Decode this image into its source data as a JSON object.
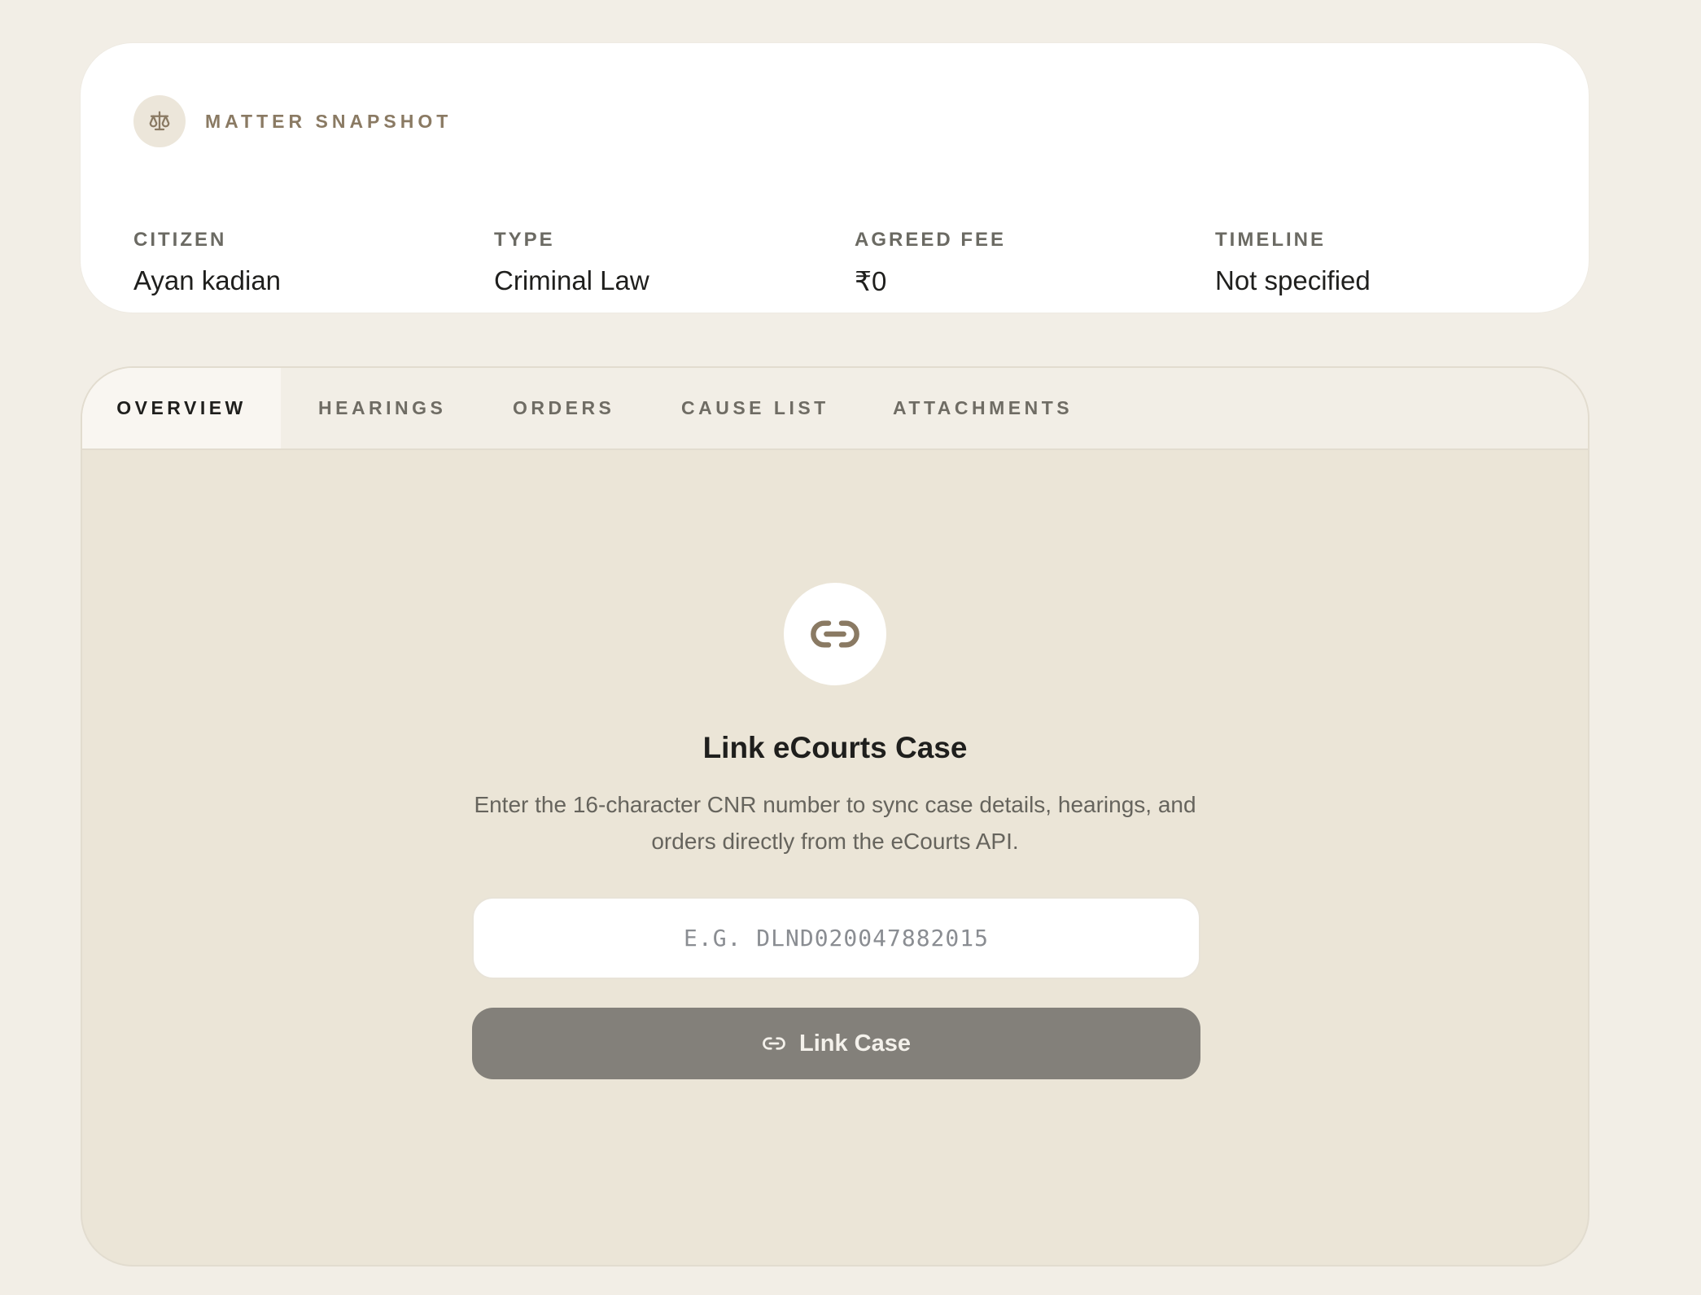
{
  "snapshot": {
    "title": "MATTER SNAPSHOT",
    "icon": "scale-icon",
    "fields": {
      "citizen": {
        "label": "CITIZEN",
        "value": "Ayan kadian"
      },
      "type": {
        "label": "TYPE",
        "value": "Criminal Law"
      },
      "fee": {
        "label": "AGREED FEE",
        "value": "₹0"
      },
      "timeline": {
        "label": "TIMELINE",
        "value": "Not specified"
      }
    }
  },
  "tabs": {
    "active": "OVERVIEW",
    "items": [
      "OVERVIEW",
      "HEARINGS",
      "ORDERS",
      "CAUSE LIST",
      "ATTACHMENTS"
    ]
  },
  "link_case": {
    "icon": "link-icon",
    "title": "Link eCourts Case",
    "description": "Enter the 16-character CNR number to sync case details, hearings, and orders directly from the eCourts API.",
    "input_value": "",
    "input_placeholder": "e.g. DLND020047882015",
    "button_label": "Link Case"
  },
  "colors": {
    "page_bg": "#f2eee6",
    "accent_brown": "#8a7a63",
    "panel_bg": "#ebe5d7",
    "button_bg": "#83807a"
  }
}
